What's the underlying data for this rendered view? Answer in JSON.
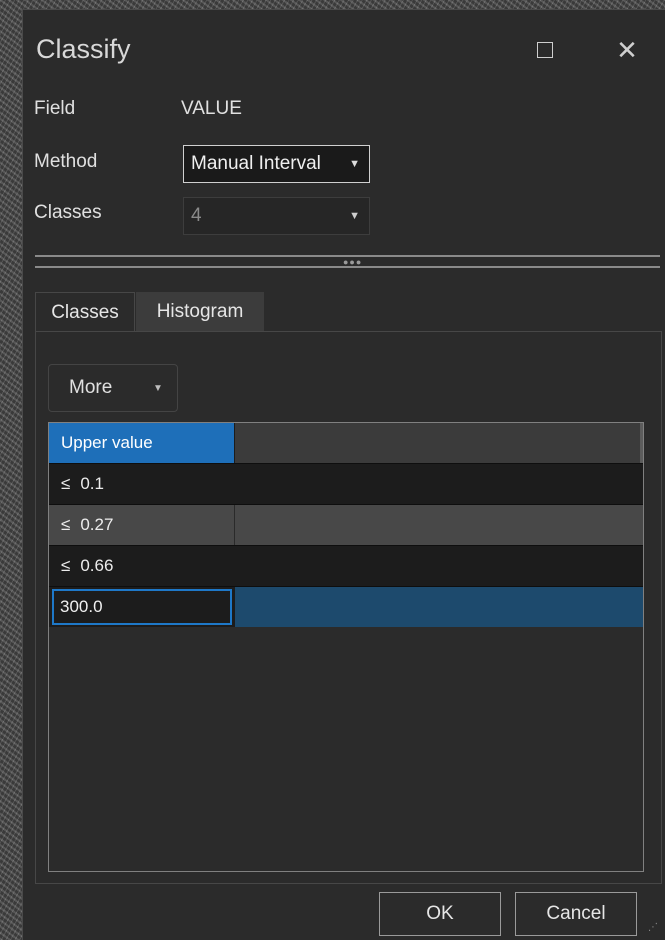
{
  "dialog": {
    "title": "Classify",
    "maximize_icon": "maximize-icon",
    "close_icon": "close-icon",
    "close_glyph": "✕"
  },
  "form": {
    "field_label": "Field",
    "field_value": "VALUE",
    "method_label": "Method",
    "method_value": "Manual Interval",
    "classes_label": "Classes",
    "classes_value": "4"
  },
  "tabs": [
    {
      "label": "Classes",
      "active": true
    },
    {
      "label": "Histogram",
      "active": false
    }
  ],
  "toolbar": {
    "more_label": "More"
  },
  "table": {
    "header": "Upper value",
    "rows": [
      {
        "prefix": "≤",
        "value": "0.1"
      },
      {
        "prefix": "≤",
        "value": "0.27"
      },
      {
        "prefix": "≤",
        "value": "0.66"
      }
    ],
    "edit_value": "300.0"
  },
  "buttons": {
    "ok": "OK",
    "cancel": "Cancel"
  },
  "colors": {
    "dialog_bg": "#2b2b2b",
    "header_accent": "#1e6fb9",
    "selected_row": "#1d4a6d",
    "edit_border": "#1e78c8"
  }
}
